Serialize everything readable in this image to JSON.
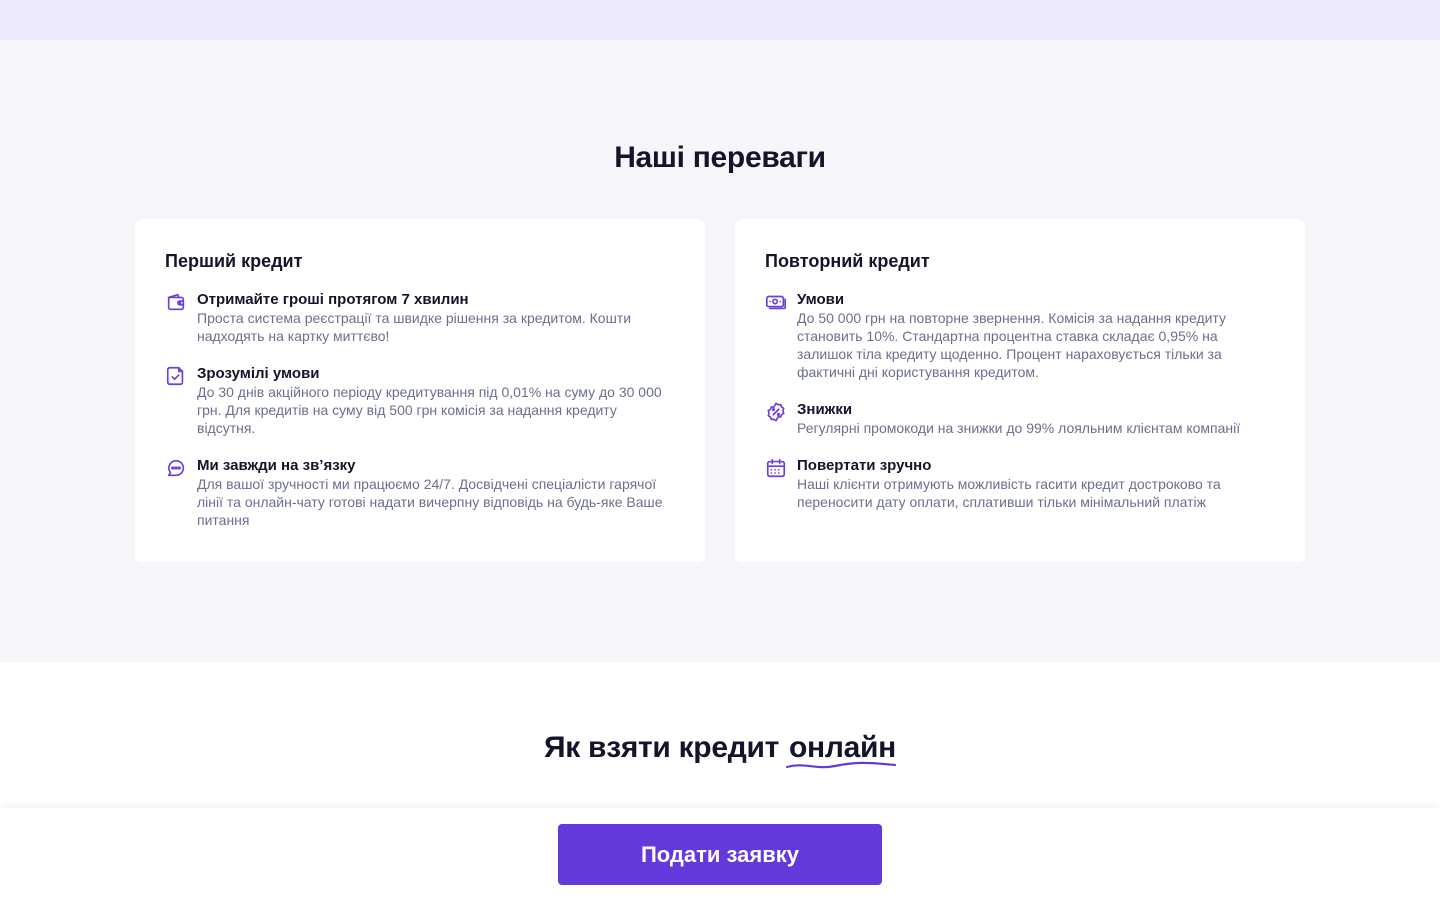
{
  "advantages": {
    "title": "Наші переваги",
    "first_credit": {
      "title": "Перший кредит",
      "items": [
        {
          "icon": "wallet-icon",
          "title": "Отримайте гроші протягом 7 хвилин",
          "desc": "Проста система реєстрації та швидке рішення за кредитом. Кошти надходять на картку миттєво!"
        },
        {
          "icon": "document-check-icon",
          "title": "Зрозумілі умови",
          "desc": "До 30 днів акційного періоду кредитування під 0,01% на суму до 30 000 грн. Для кредитів на суму від 500 грн комісія за надання кредиту відсутня."
        },
        {
          "icon": "chat-icon",
          "title": "Ми завжди на зв’язку",
          "desc": "Для вашої зручності ми працюємо 24/7. Досвідчені спеціалісти гарячої лінії та онлайн-чату готові надати вичерпну відповідь на будь-яке Ваше питання"
        }
      ]
    },
    "repeat_credit": {
      "title": "Повторний кредит",
      "items": [
        {
          "icon": "money-icon",
          "title": "Умови",
          "desc": "До 50 000 грн на повторне звернення. Комісія за надання кредиту становить 10%. Стандартна процентна ставка складає 0,95% на залишок тіла кредиту щоденно. Процент нараховується тільки за фактичні дні користування кредитом."
        },
        {
          "icon": "discount-icon",
          "title": "Знижки",
          "desc": "Регулярні промокоди на знижки до 99% лояльним клієнтам компанії"
        },
        {
          "icon": "calendar-icon",
          "title": "Повертати зручно",
          "desc": "Наші клієнти отримують можливість гасити кредит достроково та переносити дату оплати, сплативши тільки мінімальний платіж"
        }
      ]
    }
  },
  "how_to": {
    "title_main": "Як взяти кредит",
    "title_accent": "онлайн"
  },
  "cta": {
    "apply_label": "Подати заявку"
  },
  "colors": {
    "accent": "#6339dc",
    "text": "#14142b",
    "muted": "#6b6f8f",
    "section_bg": "#f5f5fa",
    "top_strip": "#eeeafd"
  }
}
